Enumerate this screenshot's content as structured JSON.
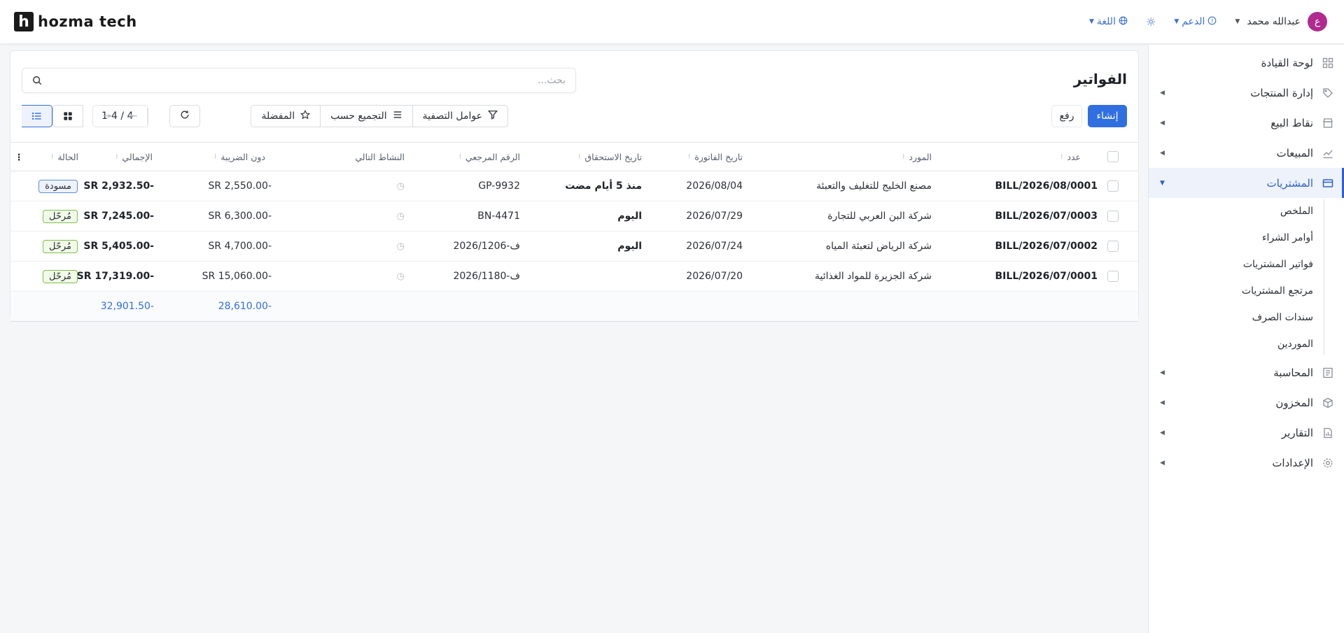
{
  "app": {
    "logo_mark": "h",
    "logo_text": "hozma tech"
  },
  "topbar": {
    "language_label": "اللغة",
    "support_label": "الدعم",
    "user_name": "عبدالله محمد",
    "avatar_letter": "ع"
  },
  "sidebar": {
    "items": [
      {
        "label": "لوحة القيادة",
        "icon": "dashboard-icon"
      },
      {
        "label": "إدارة المنتجات",
        "icon": "tag-icon"
      },
      {
        "label": "نقاط البيع",
        "icon": "store-icon"
      },
      {
        "label": "المبيعات",
        "icon": "chart-line-icon"
      },
      {
        "label": "المشتريات",
        "icon": "card-icon"
      },
      {
        "label": "المحاسبة",
        "icon": "accounting-icon"
      },
      {
        "label": "المخزون",
        "icon": "box-icon"
      },
      {
        "label": "التقارير",
        "icon": "report-icon"
      },
      {
        "label": "الإعدادات",
        "icon": "gear-icon"
      }
    ],
    "sub_items": [
      "الملخص",
      "أوامر الشراء",
      "فواتير المشتريات",
      "مرتجع المشتريات",
      "سندات الصرف",
      "الموردين"
    ]
  },
  "main": {
    "title": "الفواتير",
    "search_placeholder": "بحث...",
    "create_label": "إنشاء",
    "upload_label": "رفع",
    "filters_label": "عوامل التصفية",
    "groupby_label": "التجميع حسب",
    "favorites_label": "المفضلة",
    "pager": "1-4 / 4"
  },
  "table": {
    "headers": [
      "عدد",
      "المورد",
      "تاريخ الفاتورة",
      "تاريخ الاستحقاق",
      "الرقم المرجعي",
      "النشاط التالي",
      "دون الضريبة",
      "الإجمالي",
      "الحالة"
    ],
    "rows": [
      {
        "number": "BILL/2026/08/0001",
        "vendor": "مصنع الخليج للتغليف والتعبئة",
        "invoice_date": "2026/08/04",
        "due": "منذ 5 أيام مضت",
        "ref": "GP-9932",
        "untaxed": "SR 2,550.00-",
        "total": "SR 2,932.50-",
        "status": "مسودة",
        "status_kind": "draft"
      },
      {
        "number": "BILL/2026/07/0003",
        "vendor": "شركة البن العربي للتجارة",
        "invoice_date": "2026/07/29",
        "due": "اليوم",
        "ref": "BN-4471",
        "untaxed": "SR 6,300.00-",
        "total": "SR 7,245.00-",
        "status": "مُرحّل",
        "status_kind": "posted"
      },
      {
        "number": "BILL/2026/07/0002",
        "vendor": "شركة الرياض لتعبئة المياه",
        "invoice_date": "2026/07/24",
        "due": "اليوم",
        "ref": "ف-2026/1206",
        "untaxed": "SR 4,700.00-",
        "total": "SR 5,405.00-",
        "status": "مُرحّل",
        "status_kind": "posted"
      },
      {
        "number": "BILL/2026/07/0001",
        "vendor": "شركة الجزيرة للمواد الغذائية",
        "invoice_date": "2026/07/20",
        "due": "",
        "ref": "ف-2026/1180",
        "untaxed": "SR 15,060.00-",
        "total": "SR 17,319.00-",
        "status": "مُرحّل",
        "status_kind": "posted"
      }
    ],
    "totals": {
      "untaxed": "28,610.00-",
      "total": "32,901.50-"
    }
  },
  "colors": {
    "accent": "#2f6fe0",
    "avatar": "#b02a8f",
    "draft_border": "#5b8fd8",
    "posted_border": "#7cc04a"
  }
}
